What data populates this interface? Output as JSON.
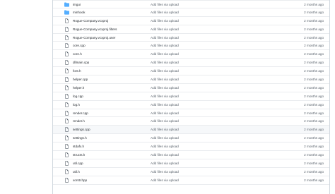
{
  "colors": {
    "folder_icon": "#54aeff",
    "file_icon": "#57606a",
    "border": "#d0d7de",
    "row_divider": "#eaecef",
    "hover_row": "#f6f8fa"
  },
  "files": [
    {
      "name": "imgui",
      "type": "folder",
      "icon": "folder-icon",
      "commit": "Add files via upload",
      "age": "2 months ago"
    },
    {
      "name": "minhook",
      "type": "folder",
      "icon": "folder-icon",
      "commit": "Add files via upload",
      "age": "2 months ago"
    },
    {
      "name": "Rogue-Company.vcxproj",
      "type": "file",
      "icon": "file-icon",
      "commit": "Add files via upload",
      "age": "2 months ago"
    },
    {
      "name": "Rogue-Company.vcxproj.filters",
      "type": "file",
      "icon": "file-icon",
      "commit": "Add files via upload",
      "age": "2 months ago"
    },
    {
      "name": "Rogue-Company.vcxproj.user",
      "type": "file",
      "icon": "file-icon",
      "commit": "Add files via upload",
      "age": "2 months ago"
    },
    {
      "name": "core.cpp",
      "type": "file",
      "icon": "file-icon",
      "commit": "Add files via upload",
      "age": "2 months ago"
    },
    {
      "name": "core.h",
      "type": "file",
      "icon": "file-icon",
      "commit": "Add files via upload",
      "age": "2 months ago"
    },
    {
      "name": "dllmain.cpp",
      "type": "file",
      "icon": "file-icon",
      "commit": "Add files via upload",
      "age": "2 months ago"
    },
    {
      "name": "font.h",
      "type": "file",
      "icon": "file-icon",
      "commit": "Add files via upload",
      "age": "2 months ago"
    },
    {
      "name": "helper.cpp",
      "type": "file",
      "icon": "file-icon",
      "commit": "Add files via upload",
      "age": "2 months ago"
    },
    {
      "name": "helper.h",
      "type": "file",
      "icon": "file-icon",
      "commit": "Add files via upload",
      "age": "2 months ago"
    },
    {
      "name": "log.cpp",
      "type": "file",
      "icon": "file-icon",
      "commit": "Add files via upload",
      "age": "2 months ago"
    },
    {
      "name": "log.h",
      "type": "file",
      "icon": "file-icon",
      "commit": "Add files via upload",
      "age": "2 months ago"
    },
    {
      "name": "render.cpp",
      "type": "file",
      "icon": "file-icon",
      "commit": "Add files via upload",
      "age": "2 months ago"
    },
    {
      "name": "render.h",
      "type": "file",
      "icon": "file-icon",
      "commit": "Add files via upload",
      "age": "2 months ago"
    },
    {
      "name": "settings.cpp",
      "type": "file",
      "icon": "file-icon",
      "commit": "Add files via upload",
      "age": "2 months ago",
      "hover": true
    },
    {
      "name": "settings.h",
      "type": "file",
      "icon": "file-icon",
      "commit": "Add files via upload",
      "age": "2 months ago"
    },
    {
      "name": "stdafx.h",
      "type": "file",
      "icon": "file-icon",
      "commit": "Add files via upload",
      "age": "2 months ago"
    },
    {
      "name": "structs.h",
      "type": "file",
      "icon": "file-icon",
      "commit": "Add files via upload",
      "age": "2 months ago"
    },
    {
      "name": "util.cpp",
      "type": "file",
      "icon": "file-icon",
      "commit": "Add files via upload",
      "age": "2 months ago"
    },
    {
      "name": "util.h",
      "type": "file",
      "icon": "file-icon",
      "commit": "Add files via upload",
      "age": "2 months ago"
    },
    {
      "name": "xorstr.hpp",
      "type": "file",
      "icon": "file-icon",
      "commit": "Add files via upload",
      "age": "2 months ago"
    }
  ]
}
